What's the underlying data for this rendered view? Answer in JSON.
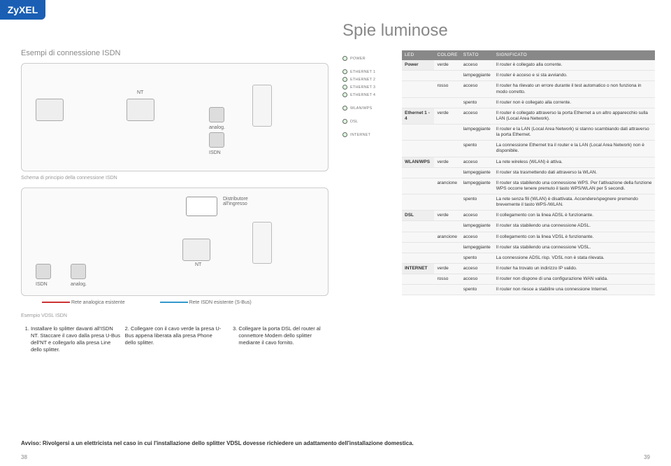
{
  "brand": "ZyXEL",
  "page_title": "Spie luminose",
  "left": {
    "section_title": "Esempi di connessione ISDN",
    "nt_label": "NT",
    "analog_label": "analog.",
    "isdn_label": "ISDN",
    "schema_caption": "Schema di principio della connessione ISDN",
    "distributor_label": "Distributore all'ingresso",
    "nt_label2": "NT",
    "isdn_label2": "ISDN",
    "analog_label2": "analog.",
    "legend_analog": "Rete analogica esistente",
    "legend_isdn": "Rete ISDN esistente (S-Bus)",
    "esempio_label": "Esempio VDSL ISDN",
    "steps": {
      "s1": "Installare lo splitter davanti all'ISDN NT. Staccare il cavo dalla presa U-Bus dell'NT e collegarlo alla presa Line dello splitter.",
      "s2": "Collegare con il cavo verde la presa U-Bus appena liberata alla presa Phone dello splitter.",
      "s3": "Collegare la porta DSL del router al connettore Modem dello splitter mediante il cavo fornito."
    }
  },
  "led_panel_labels": [
    "POWER",
    "ETHERNET 1",
    "ETHERNET 2",
    "ETHERNET 3",
    "ETHERNET 4",
    "WLAN/WPS",
    "DSL",
    "INTERNET"
  ],
  "table": {
    "headers": [
      "LED",
      "COLORE",
      "STATO",
      "SIGNIFICATO"
    ],
    "rows": [
      [
        "Power",
        "verde",
        "acceso",
        "Il router è collegato alla corrente."
      ],
      [
        "",
        "",
        "lampeggiante",
        "Il router è acceso e si sta avviando."
      ],
      [
        "",
        "rosso",
        "acceso",
        "Il router ha rilevato un errore durante il test automatico o non funziona in modo corretto."
      ],
      [
        "",
        "",
        "spento",
        "Il router non è collegato alla corrente."
      ],
      [
        "Ethernet 1 - 4",
        "verde",
        "acceso",
        "Il router è collegato attraverso la porta Ethernet a un altro apparecchio sulla LAN (Local Area Network)."
      ],
      [
        "",
        "",
        "lampeggiante",
        "Il router e la LAN (Local Area Network) si stanno scambiando dati attraverso la porta Ethernet."
      ],
      [
        "",
        "",
        "spento",
        "La connessione Ethernet tra il router e la LAN (Local Area Network) non è disponibile."
      ],
      [
        "WLAN/WPS",
        "verde",
        "acceso",
        "La rete wireless (WLAN) è attiva."
      ],
      [
        "",
        "",
        "lampeggiante",
        "Il router sta trasmettendo dati attraverso la WLAN."
      ],
      [
        "",
        "arancione",
        "lampeggiante",
        "Il router sta stabilendo una connessione WPS. Per l'attivazione della funzione WPS occorre tenere premuto il tasto WPS/WLAN per 5 secondi."
      ],
      [
        "",
        "",
        "spento",
        "La rete senza fili (WLAN) è disattivata. Accendere/spegnere premendo brevemente il tasto WPS-/WLAN."
      ],
      [
        "DSL",
        "verde",
        "acceso",
        "Il collegamento con la linea ADSL è funzionante."
      ],
      [
        "",
        "",
        "lampeggiante",
        "Il router sta stabilendo una connessione ADSL."
      ],
      [
        "",
        "arancione",
        "acceso",
        "Il collegamento con la linea VDSL è funzionante."
      ],
      [
        "",
        "",
        "lampeggiante",
        "Il router sta stabilendo una connessione VDSL."
      ],
      [
        "",
        "",
        "spento",
        "La connessione ADSL risp. VDSL non è stata rilevata."
      ],
      [
        "INTERNET",
        "verde",
        "acceso",
        "Il router ha trovato un indirizzo IP valido."
      ],
      [
        "",
        "rosso",
        "acceso",
        "Il router non dispone di una configurazione WAN valida."
      ],
      [
        "",
        "",
        "spento",
        "Il router non riesce a stabilire una connessione Internet."
      ]
    ]
  },
  "notice": "Avviso: Rivolgersi a un elettricista nel caso in cui l'installazione dello splitter VDSL dovesse richiedere un adattamento dell'installazione domestica.",
  "page_left": "38",
  "page_right": "39"
}
